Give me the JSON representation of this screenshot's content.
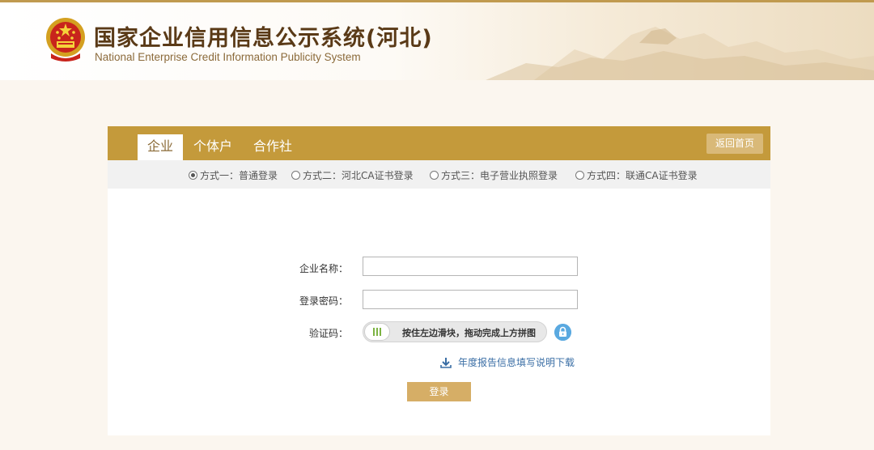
{
  "header": {
    "title_cn": "国家企业信用信息公示系统(河北)",
    "title_en": "National Enterprise Credit Information Publicity System"
  },
  "tabs": [
    {
      "label": "企业",
      "active": true
    },
    {
      "label": "个体户",
      "active": false
    },
    {
      "label": "合作社",
      "active": false
    }
  ],
  "home_button": "返回首页",
  "login_methods": [
    {
      "label": "方式一：普通登录",
      "checked": true
    },
    {
      "label": "方式二：河北CA证书登录",
      "checked": false
    },
    {
      "label": "方式三：电子营业执照登录",
      "checked": false
    },
    {
      "label": "方式四：联通CA证书登录",
      "checked": false
    }
  ],
  "form": {
    "company_name_label": "企业名称：",
    "company_name_value": "",
    "password_label": "登录密码：",
    "password_value": "",
    "captcha_label": "验证码：",
    "slider_text": "按住左边滑块，拖动完成上方拼图"
  },
  "download_link": "年度报告信息填写说明下载",
  "login_button": "登录",
  "colors": {
    "header_brown": "#5a3a17",
    "tab_bar_gold": "#c49a3b",
    "button_gold": "#d6ae66",
    "link_blue": "#3a6ea5",
    "lock_blue": "#5aa9e0"
  },
  "icons": [
    "national-emblem-icon",
    "radio-icon",
    "slider-handle-icon",
    "lock-icon",
    "download-icon"
  ]
}
